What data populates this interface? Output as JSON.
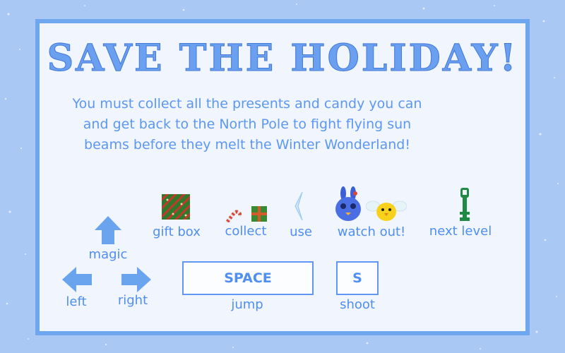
{
  "title": "SAVE THE HOLIDAY!",
  "description": "You must collect all the presents and candy you can and get back to the North Pole to fight flying sun beams before they melt the Winter Wonderland!",
  "legend": {
    "gift_box": "gift box",
    "collect": "collect",
    "use": "use",
    "watch_out": "watch out!",
    "next_level": "next level"
  },
  "controls": {
    "magic": "magic",
    "left": "left",
    "right": "right",
    "space_key": "SPACE",
    "jump": "jump",
    "s_key": "S",
    "shoot": "shoot"
  },
  "colors": {
    "background": "#a9c8f4",
    "panel_border": "#6fa6f0",
    "panel": "#f1f5fd",
    "accent": "#4f8ef2"
  },
  "icons": [
    "gift-box-tile-icon",
    "candy-cane-icon",
    "present-icon",
    "ice-crystal-icon",
    "blue-bunny-enemy-icon",
    "yellow-chick-enemy-icon",
    "green-key-icon",
    "up-arrow-icon",
    "left-arrow-icon",
    "right-arrow-icon"
  ]
}
